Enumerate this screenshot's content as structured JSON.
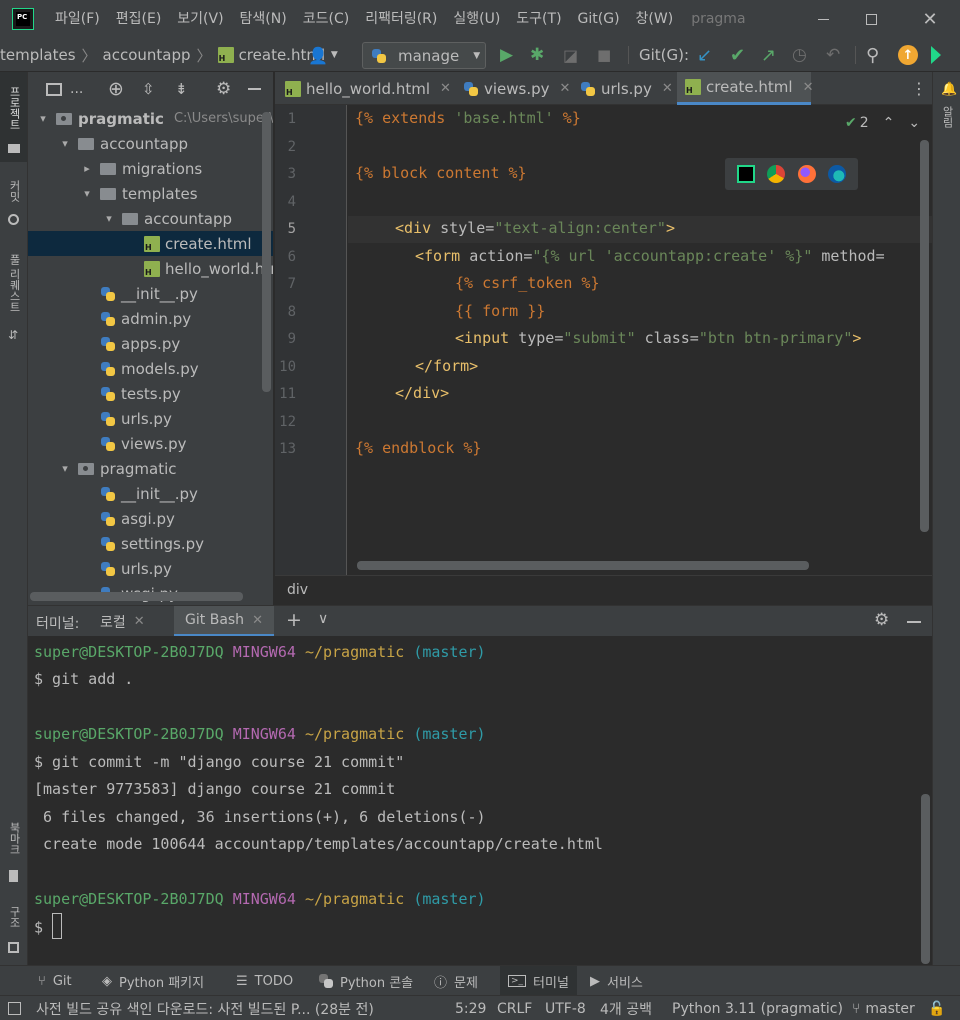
{
  "menu": {
    "items": [
      "파일(F)",
      "편집(E)",
      "보기(V)",
      "탐색(N)",
      "코드(C)",
      "리팩터링(R)",
      "실행(U)",
      "도구(T)",
      "Git(G)",
      "창(W)"
    ],
    "project_title": "pragma",
    "logo_text": "PC"
  },
  "toolbar": {
    "breadcrumb_templates": "templates",
    "breadcrumb_accountapp": "accountapp",
    "breadcrumb_file": "create.html",
    "run_config": "manage",
    "git_label": "Git(G):"
  },
  "left_stripe": {
    "project": "프로젝트",
    "commit": "커밋",
    "pull_requests": "풀 리퀘스트",
    "bookmarks": "북마크",
    "structure": "구조"
  },
  "right_stripe": {
    "notifications": "알림"
  },
  "project_panel": {
    "header_label": "...",
    "tree": [
      {
        "label": "pragmatic",
        "extra": "C:\\Users\\super\\",
        "type": "folder",
        "arrow": "▾"
      },
      {
        "label": "accountapp",
        "type": "folder",
        "arrow": "▾"
      },
      {
        "label": "migrations",
        "type": "folder",
        "arrow": "▸"
      },
      {
        "label": "templates",
        "type": "folder",
        "arrow": "▾"
      },
      {
        "label": "accountapp",
        "type": "folder",
        "arrow": "▾"
      },
      {
        "label": "create.html",
        "type": "html",
        "arrow": ""
      },
      {
        "label": "hello_world.html",
        "type": "html",
        "arrow": ""
      },
      {
        "label": "__init__.py",
        "type": "py",
        "arrow": ""
      },
      {
        "label": "admin.py",
        "type": "py",
        "arrow": ""
      },
      {
        "label": "apps.py",
        "type": "py",
        "arrow": ""
      },
      {
        "label": "models.py",
        "type": "py",
        "arrow": ""
      },
      {
        "label": "tests.py",
        "type": "py",
        "arrow": ""
      },
      {
        "label": "urls.py",
        "type": "py",
        "arrow": ""
      },
      {
        "label": "views.py",
        "type": "py",
        "arrow": ""
      },
      {
        "label": "pragmatic",
        "type": "folder",
        "arrow": "▾"
      },
      {
        "label": "__init__.py",
        "type": "py",
        "arrow": ""
      },
      {
        "label": "asgi.py",
        "type": "py",
        "arrow": ""
      },
      {
        "label": "settings.py",
        "type": "py",
        "arrow": ""
      },
      {
        "label": "urls.py",
        "type": "py",
        "arrow": ""
      },
      {
        "label": "wsgi.py",
        "type": "py",
        "arrow": ""
      }
    ]
  },
  "editor_tabs": [
    {
      "label": "hello_world.html",
      "type": "html",
      "active": false
    },
    {
      "label": "views.py",
      "type": "py",
      "active": false
    },
    {
      "label": "urls.py",
      "type": "py",
      "active": false
    },
    {
      "label": "create.html",
      "type": "html",
      "active": true
    }
  ],
  "editor": {
    "line_numbers": [
      "1",
      "2",
      "3",
      "4",
      "5",
      "6",
      "7",
      "8",
      "9",
      "10",
      "11",
      "12",
      "13"
    ],
    "current_line": "5",
    "inspection_count": "2",
    "breadcrumb": "div",
    "code": {
      "l1_a": "{% extends ",
      "l1_b": "'base.html'",
      "l1_c": " %}",
      "l3": "{% block content %}",
      "l5_a": "<div ",
      "l5_b": "style=",
      "l5_c": "\"text-align:center\"",
      "l5_d": ">",
      "l6_a": "<form ",
      "l6_b": "action=",
      "l6_c": "\"{% url 'accountapp:create' %}\"",
      "l6_d": " method=",
      "l7": "{% csrf_token %}",
      "l8": "{{ form }}",
      "l9_a": "<input ",
      "l9_b": "type=",
      "l9_c": "\"submit\"",
      "l9_d": " class=",
      "l9_e": "\"btn btn-primary\"",
      "l9_f": ">",
      "l10": "</form>",
      "l11": "</div>",
      "l13": "{% endblock %}"
    }
  },
  "terminal": {
    "header_label": "터미널:",
    "tabs": [
      {
        "label": "로컬",
        "active": false
      },
      {
        "label": "Git Bash",
        "active": true
      }
    ],
    "prompt_user": "super@DESKTOP-2B0J7DQ",
    "prompt_env": "MINGW64",
    "prompt_path": "~/pragmatic",
    "prompt_branch": "(master)",
    "cmd1": "$ git add .",
    "cmd2": "$ git commit -m \"django course 21 commit\"",
    "out1": "[master 9773583] django course 21 commit",
    "out2": " 6 files changed, 36 insertions(+), 6 deletions(-)",
    "out3": " create mode 100644 accountapp/templates/accountapp/create.html",
    "cmd3": "$ "
  },
  "tool_windows": [
    "Git",
    "Python 패키지",
    "TODO",
    "Python 콘솔",
    "문제",
    "터미널",
    "서비스"
  ],
  "status": {
    "message": "사전 빌드 공유 색인 다운로드: 사전 빌드된 P... (28분 전)",
    "position": "5:29",
    "line_sep": "CRLF",
    "encoding": "UTF-8",
    "indent": "4개 공백",
    "interpreter": "Python 3.11 (pragmatic)",
    "branch": "master"
  },
  "colors": {
    "accent": "#4a88c7",
    "run_green": "#59a869",
    "git_update": "#3592c4",
    "update_badge": "#f0a732"
  }
}
